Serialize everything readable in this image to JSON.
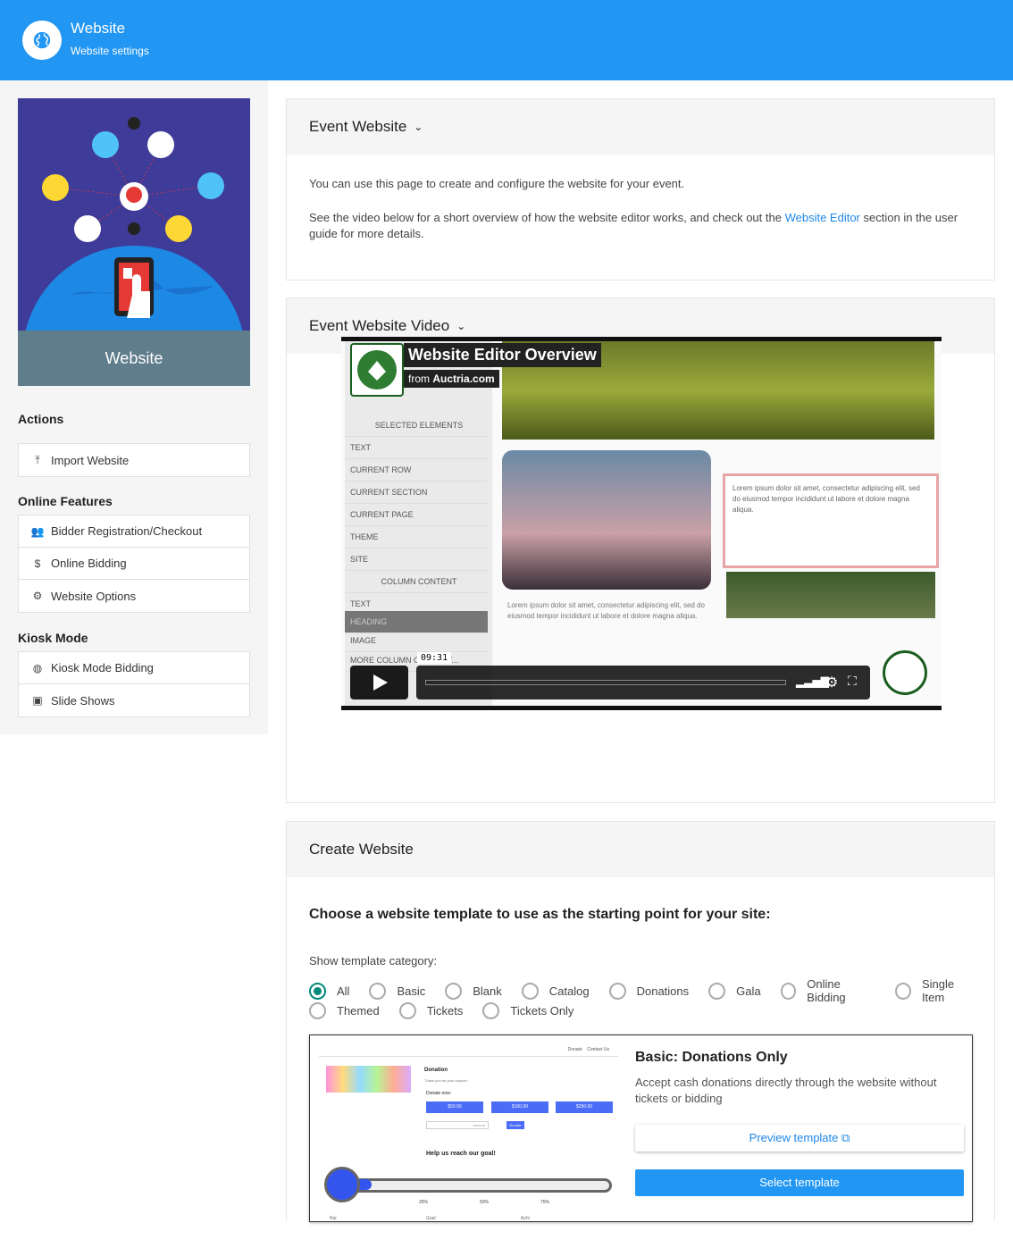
{
  "header": {
    "title": "Website",
    "subtitle": "Website settings",
    "icon": "globe-icon"
  },
  "sidebar": {
    "hero_caption": "Website",
    "actions_heading": "Actions",
    "actions": [
      {
        "label": "Import Website",
        "icon": "upload-icon"
      }
    ],
    "online_heading": "Online Features",
    "online": [
      {
        "label": "Bidder Registration/Checkout",
        "icon": "people-icon"
      },
      {
        "label": "Online Bidding",
        "icon": "dollar-icon"
      },
      {
        "label": "Website Options",
        "icon": "gear-icon"
      }
    ],
    "kiosk_heading": "Kiosk Mode",
    "kiosk": [
      {
        "label": "Kiosk Mode Bidding",
        "icon": "globe-icon"
      },
      {
        "label": "Slide Shows",
        "icon": "slideshow-icon"
      }
    ]
  },
  "event_website": {
    "title": "Event Website",
    "p1": "You can use this page to create and configure the website for your event.",
    "p2_before": "See the video below for a short overview of how the website editor works, and check out the",
    "p2_link": "Website Editor",
    "p2_after": "section in the user guide for more details."
  },
  "video_card": {
    "title": "Event Website Video",
    "video_title": "Website Editor Overview",
    "video_from": "from",
    "video_source": "Auctria.com",
    "time": "09:31",
    "panel": [
      "SELECTED ELEMENTS",
      "TEXT",
      "CURRENT ROW",
      "CURRENT SECTION",
      "CURRENT PAGE",
      "THEME",
      "SITE",
      "COLUMN CONTENT",
      "TEXT",
      "HEADING",
      "IMAGE",
      "MORE COLUMN CONTENT..."
    ]
  },
  "create": {
    "title": "Create Website",
    "heading": "Choose a website template to use as the starting point for your site:",
    "category_label": "Show template category:",
    "categories_row1": [
      "All",
      "Basic",
      "Blank",
      "Catalog",
      "Donations",
      "Gala",
      "Online Bidding",
      "Single Item"
    ],
    "categories_row2": [
      "Themed",
      "Tickets",
      "Tickets Only"
    ],
    "selected_category": "All",
    "template": {
      "name": "Basic: Donations Only",
      "description": "Accept cash donations directly through the website without tickets or bidding",
      "preview_label": "Preview template",
      "select_label": "Select template",
      "thumb": {
        "nav": [
          "Donate",
          "Contact Us"
        ],
        "heading": "Donation",
        "thanks": "Thank you for your support.",
        "donate_now": "Donate now:",
        "amounts": [
          "$50.00",
          "$100.00",
          "$250.00"
        ],
        "amount_placeholder": "Amount",
        "donate_btn": "Donate",
        "goal_text": "Help us reach our goal!",
        "ticks": [
          "25%",
          "50%",
          "75%"
        ],
        "foot": [
          "Rai",
          "Goal",
          "Achi"
        ]
      }
    }
  }
}
